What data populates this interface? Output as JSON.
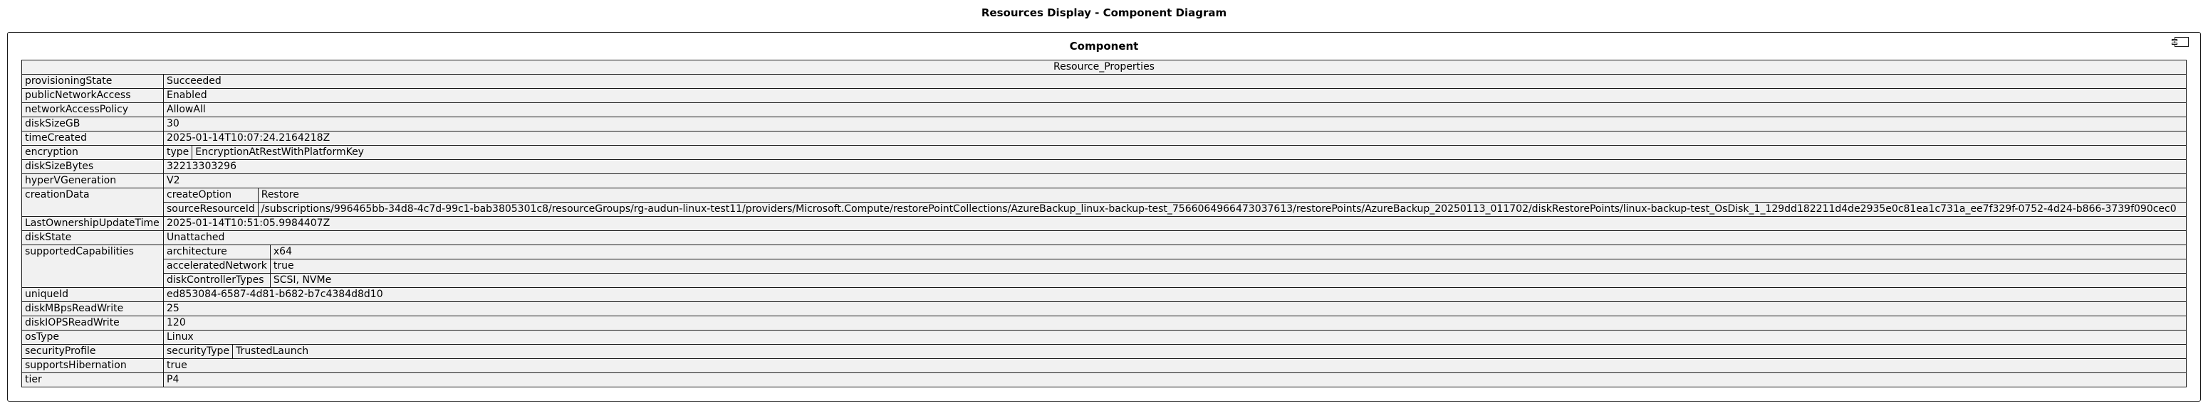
{
  "title": "Resources Display - Component Diagram",
  "component": {
    "title": "Component",
    "header": "Resource_Properties"
  },
  "rows": [
    {
      "key": "provisioningState",
      "value": "Succeeded"
    },
    {
      "key": "publicNetworkAccess",
      "value": "Enabled"
    },
    {
      "key": "networkAccessPolicy",
      "value": "AllowAll"
    },
    {
      "key": "diskSizeGB",
      "value": "30"
    },
    {
      "key": "timeCreated",
      "value": "2025-01-14T10:07:24.2164218Z"
    },
    {
      "key": "encryption",
      "sub": [
        {
          "key": "type",
          "value": "EncryptionAtRestWithPlatformKey"
        }
      ]
    },
    {
      "key": "diskSizeBytes",
      "value": "32213303296"
    },
    {
      "key": "hyperVGeneration",
      "value": "V2"
    },
    {
      "key": "creationData",
      "sub": [
        {
          "key": "createOption",
          "value": "Restore"
        },
        {
          "key": "sourceResourceId",
          "value": "/subscriptions/996465bb-34d8-4c7d-99c1-bab3805301c8/resourceGroups/rg-audun-linux-test11/providers/Microsoft.Compute/restorePointCollections/AzureBackup_linux-backup-test_7566064966473037613/restorePoints/AzureBackup_20250113_011702/diskRestorePoints/linux-backup-test_OsDisk_1_129dd182211d4de2935e0c81ea1c731a_ee7f329f-0752-4d24-b866-3739f090cec0"
        }
      ]
    },
    {
      "key": "LastOwnershipUpdateTime",
      "value": "2025-01-14T10:51:05.9984407Z"
    },
    {
      "key": "diskState",
      "value": "Unattached"
    },
    {
      "key": "supportedCapabilities",
      "sub": [
        {
          "key": "architecture",
          "value": "x64"
        },
        {
          "key": "acceleratedNetwork",
          "value": "true"
        },
        {
          "key": "diskControllerTypes",
          "value": "SCSI, NVMe"
        }
      ]
    },
    {
      "key": "uniqueId",
      "value": "ed853084-6587-4d81-b682-b7c4384d8d10"
    },
    {
      "key": "diskMBpsReadWrite",
      "value": "25"
    },
    {
      "key": "diskIOPSReadWrite",
      "value": "120"
    },
    {
      "key": "osType",
      "value": "Linux"
    },
    {
      "key": "securityProfile",
      "sub": [
        {
          "key": "securityType",
          "value": "TrustedLaunch"
        }
      ]
    },
    {
      "key": "supportsHibernation",
      "value": "true"
    },
    {
      "key": "tier",
      "value": "P4"
    }
  ]
}
